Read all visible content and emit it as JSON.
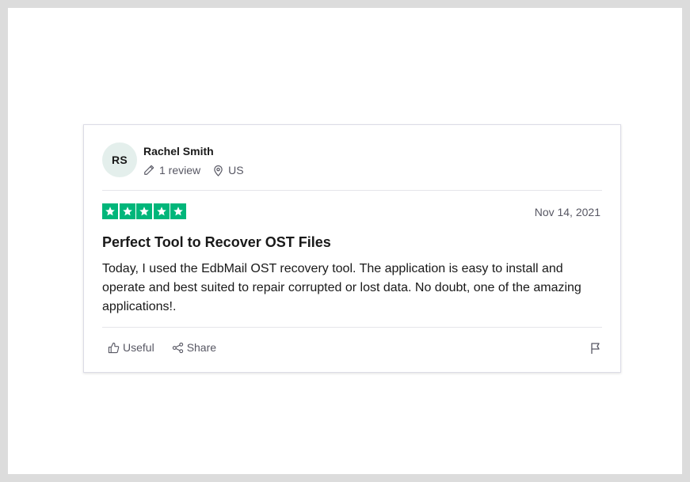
{
  "review": {
    "avatar_initials": "RS",
    "reviewer_name": "Rachel Smith",
    "review_count": "1 review",
    "location": "US",
    "rating": 5,
    "rating_max": 5,
    "star_color": "#00b67a",
    "date": "Nov 14, 2021",
    "title": "Perfect Tool to Recover OST Files",
    "body": "Today, I used the EdbMail OST recovery tool. The application is easy to install and operate and best suited to repair corrupted or lost data. No doubt, one of the amazing applications!."
  },
  "actions": {
    "useful_label": "Useful",
    "share_label": "Share"
  },
  "icons": {
    "review_count": "pencil-icon",
    "location": "location-pin-icon",
    "useful": "thumbs-up-icon",
    "share": "share-icon",
    "report": "flag-icon"
  }
}
